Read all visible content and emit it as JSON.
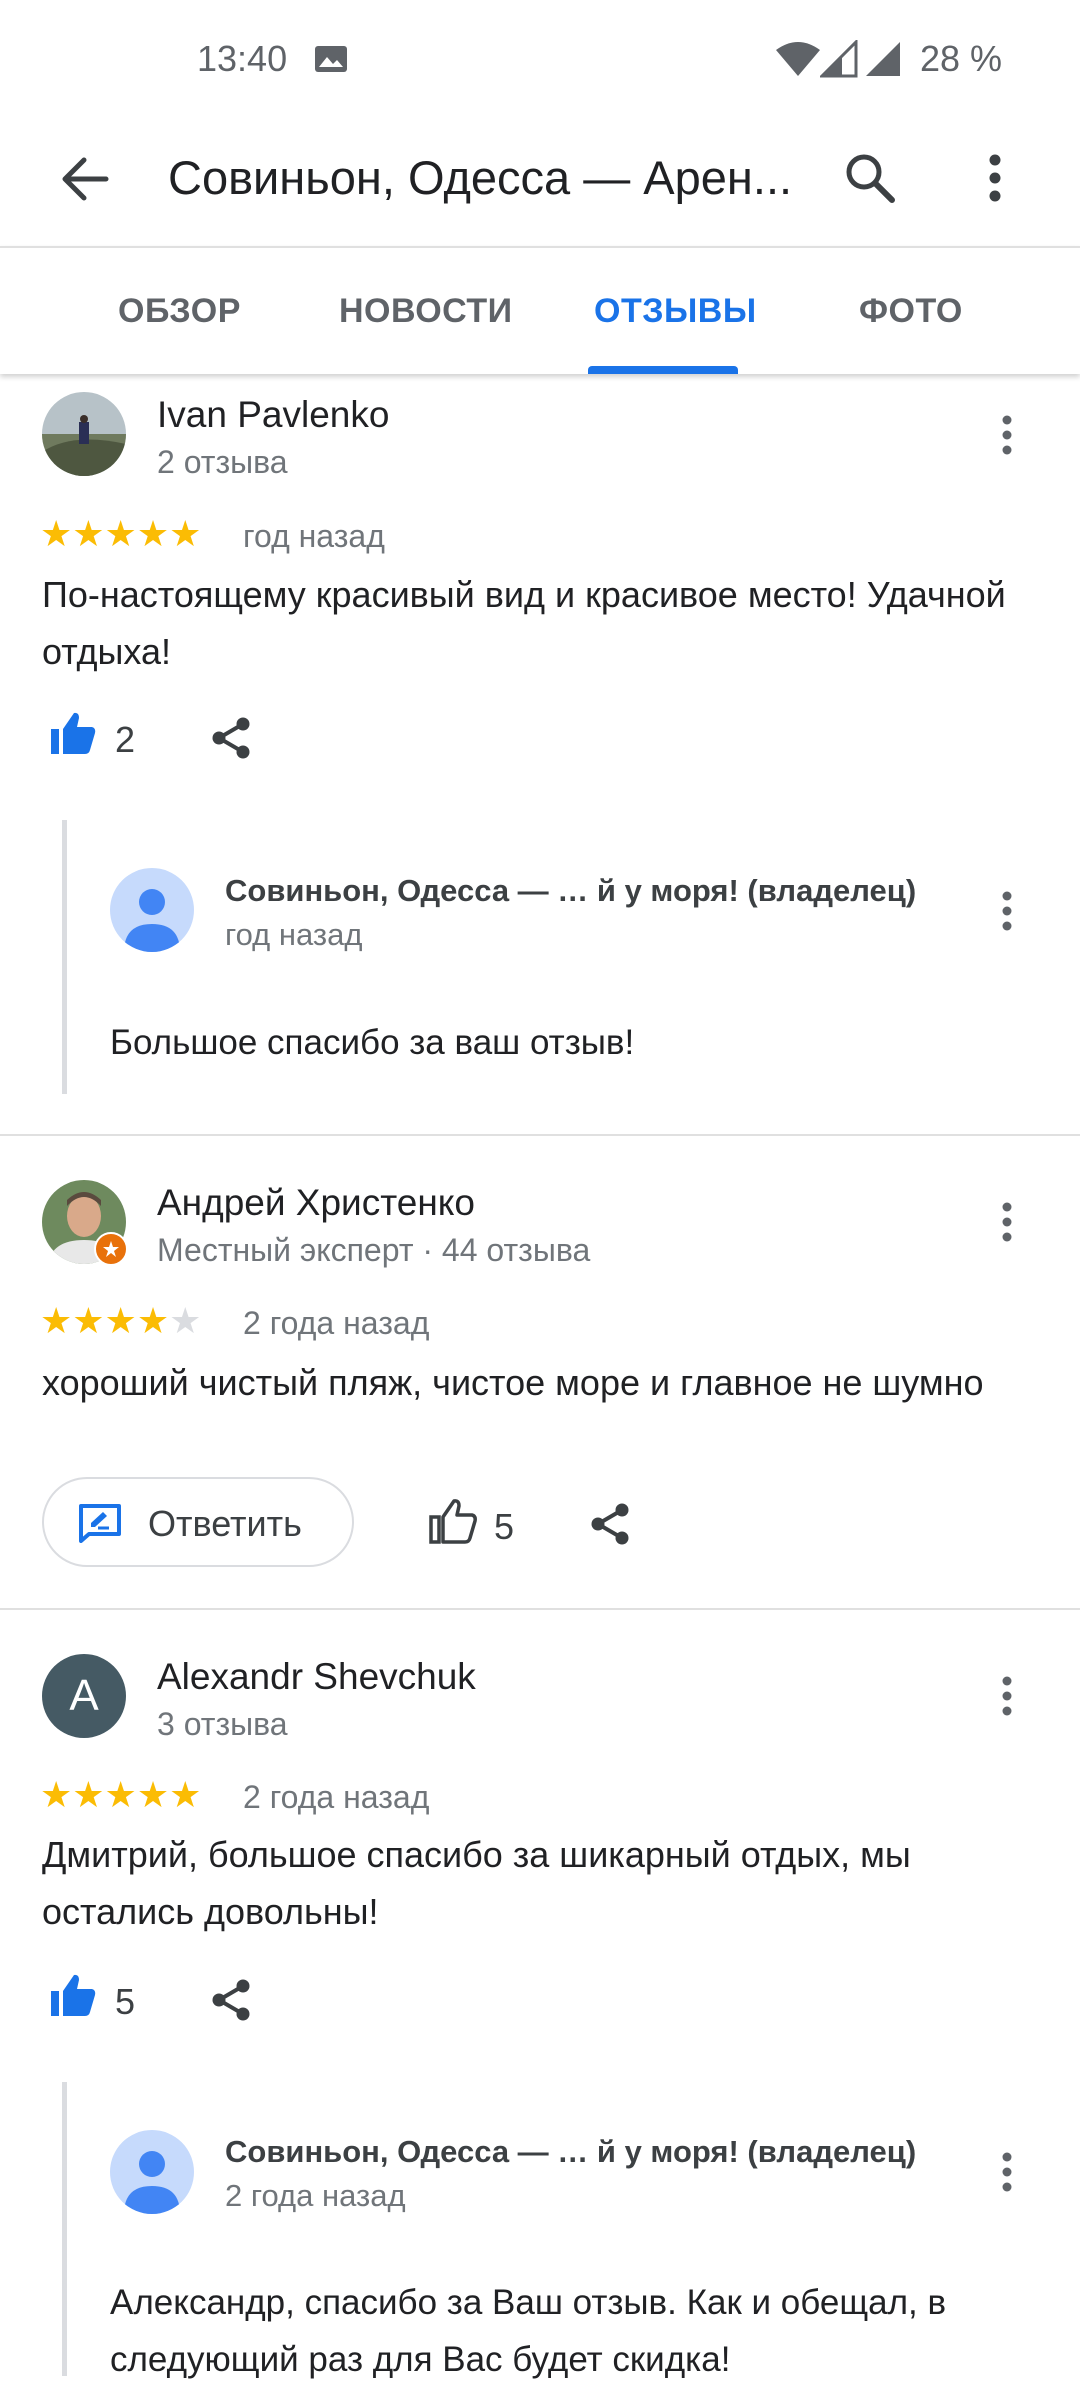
{
  "status_bar": {
    "time": "13:40",
    "battery": "28 %"
  },
  "app_bar": {
    "title": "Совиньон, Одесса — Арен..."
  },
  "tabs": [
    {
      "label": "ОБЗОР",
      "active": false
    },
    {
      "label": "НОВОСТИ",
      "active": false
    },
    {
      "label": "ОТЗЫВЫ",
      "active": true
    },
    {
      "label": "ФОТО",
      "active": false
    }
  ],
  "reviews": [
    {
      "name": "Ivan Pavlenko",
      "sub": "2 отзыва",
      "rating": 5,
      "time": "год назад",
      "text": "По-настоящему красивый вид и красивое место! Удачной отдыха!",
      "likes": "2",
      "owner_reply": {
        "name": "Совиньон, Одесса — …  й у моря! (владелец)",
        "time": "год назад",
        "text": "Большое спасибо за ваш отзыв!"
      }
    },
    {
      "name": "Андрей Христенко",
      "sub": "Местный эксперт · 44 отзыва",
      "rating": 4,
      "time": "2 года назад",
      "text": "хороший чистый пляж, чистое море и главное не шумно",
      "reply_button": "Ответить",
      "likes": "5"
    },
    {
      "name": "Alexandr Shevchuk",
      "avatar_letter": "A",
      "sub": "3 отзыва",
      "rating": 5,
      "time": "2 года назад",
      "text": "Дмитрий, большое спасибо за шикарный отдых, мы остались довольны!",
      "likes": "5",
      "owner_reply": {
        "name": "Совиньон, Одесса — …  й у моря! (владелец)",
        "time": "2 года назад",
        "text": "Александр, спасибо за Ваш отзыв. Как и обещал, в следующий раз для Вас будет скидка!"
      }
    }
  ],
  "colors": {
    "accent": "#1a73e8",
    "star": "#fbbc04",
    "star_off": "#dadce0"
  }
}
